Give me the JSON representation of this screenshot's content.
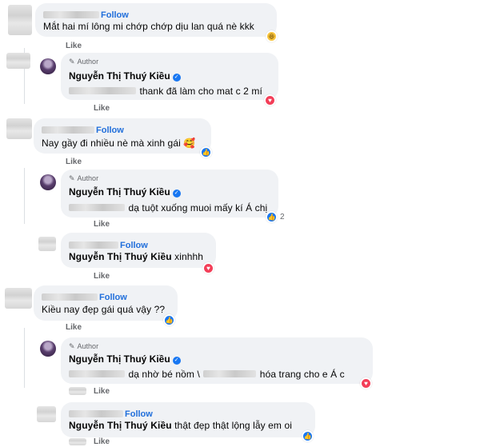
{
  "follow_label": "Follow",
  "like_label": "Like",
  "author_tag": "Author",
  "author_name": "Nguyễn Thị Thuý Kiều",
  "comments": [
    {
      "text": "Mắt hai mí lông mi chớp chớp dịu lan quá nè kkk",
      "reaction": "haha"
    },
    {
      "text": "thank đã làm cho mat c 2 mí",
      "reaction": "love"
    },
    {
      "text": "Nay gầy đi nhiều nè mà xinh gái",
      "reaction": "like"
    },
    {
      "text": "dạ tuột xuống muoi mấy kí Á chị",
      "reaction": "like",
      "reaction_count": "2"
    },
    {
      "text": "xinhhh",
      "reaction": "love"
    },
    {
      "text": "Kiều nay đẹp gái quá vậy ??",
      "reaction": "like"
    },
    {
      "text_a": "dạ nhờ bé nồm \\",
      "text_b": "hóa trang cho e Á c",
      "reaction": "love"
    },
    {
      "name_prefix": "S.....e ...ran",
      "text": "thật đẹp thật lộng lẫy em oi",
      "reaction": "like"
    }
  ]
}
